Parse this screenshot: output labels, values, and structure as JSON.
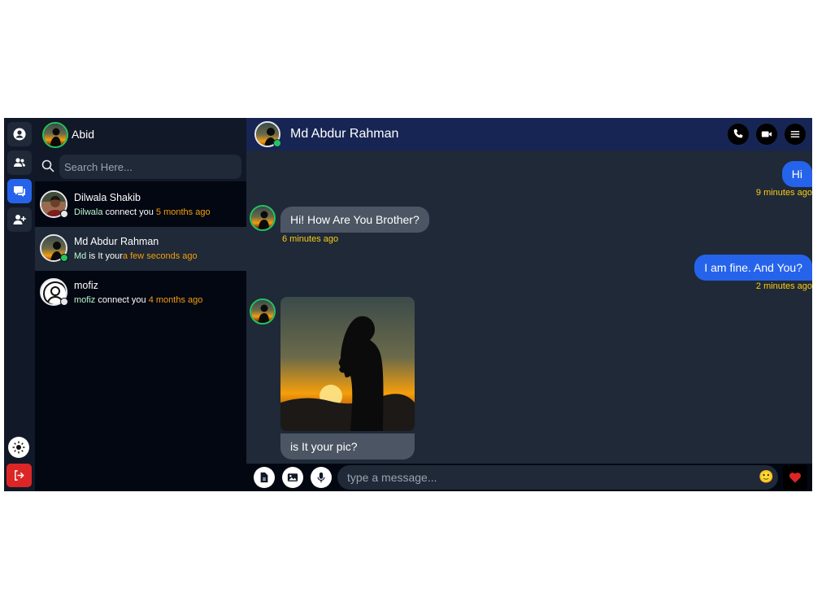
{
  "me": {
    "name": "Abid",
    "avatar_icon": "silhouette-avatar"
  },
  "rail": {
    "items": [
      {
        "icon": "user-circle-icon"
      },
      {
        "icon": "users-icon"
      },
      {
        "icon": "chat-bubbles-icon",
        "active": true
      },
      {
        "icon": "user-plus-icon"
      }
    ],
    "theme_icon": "sun-icon",
    "logout_icon": "logout-icon",
    "accent": "#2563eb",
    "danger": "#dc2626"
  },
  "search": {
    "placeholder": "Search Here..."
  },
  "contacts": [
    {
      "name": "Dilwala Shakib",
      "who": "Dilwala",
      "preview": " connect you ",
      "time": "5 months ago",
      "online": false
    },
    {
      "name": "Md Abdur Rahman",
      "who": "Md",
      "preview": " is It your",
      "time": "a few seconds ago",
      "online": true,
      "active": true
    },
    {
      "name": "mofiz",
      "who": "mofiz",
      "preview": " connect you ",
      "time": "4 months ago",
      "online": false
    }
  ],
  "chat": {
    "title": "Md Abdur Rahman",
    "header_icons": [
      "phone-icon",
      "video-icon",
      "menu-icon"
    ],
    "messages": [
      {
        "dir": "out",
        "text": "Hi",
        "time": "9 minutes ago"
      },
      {
        "dir": "in",
        "text": "Hi! How Are You Brother?",
        "time": "6 minutes ago"
      },
      {
        "dir": "out",
        "text": "I am fine. And You?",
        "time": "2 minutes ago"
      },
      {
        "dir": "in",
        "type": "image",
        "caption": "is It your pic?"
      }
    ]
  },
  "composer": {
    "placeholder": "type a message...",
    "icons": [
      "file-icon",
      "image-icon",
      "mic-icon",
      "emoji-icon",
      "heart-icon"
    ],
    "emoji": "🙂"
  }
}
